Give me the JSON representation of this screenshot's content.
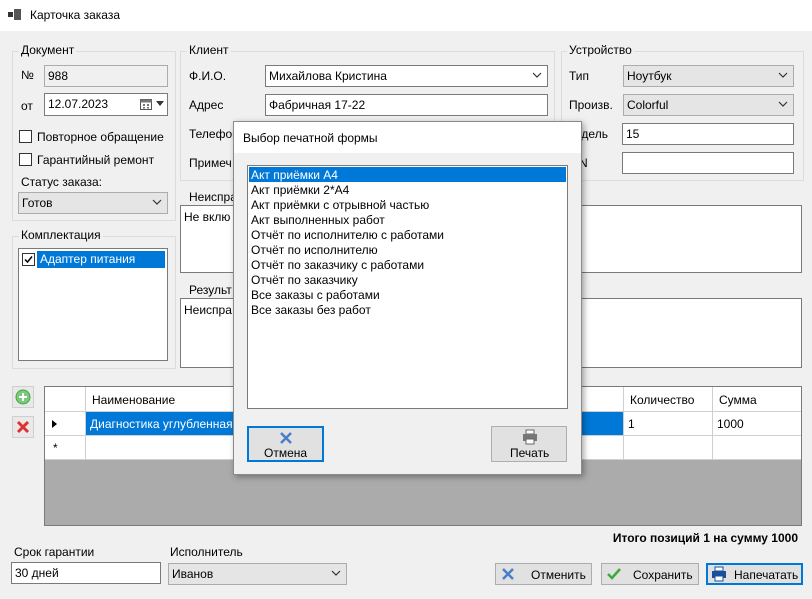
{
  "window": {
    "title": "Карточка заказа"
  },
  "document": {
    "group_title": "Документ",
    "number_label": "№",
    "number_value": "988",
    "date_label": "от",
    "date_value": "12.07.2023",
    "repeat_label": "Повторное обращение",
    "warranty_repair_label": "Гарантийный ремонт",
    "status_label": "Статус заказа:",
    "status_value": "Готов"
  },
  "client": {
    "group_title": "Клиент",
    "fio_label": "Ф.И.О.",
    "fio_value": "Михайлова Кристина",
    "address_label": "Адрес",
    "address_value": "Фабричная 17-22",
    "phone_label": "Телефон",
    "note_label": "Примеч"
  },
  "device": {
    "group_title": "Устройство",
    "type_label": "Тип",
    "type_value": "Ноутбук",
    "maker_label": "Произв.",
    "maker_value": "Colorful",
    "model_label": "одель",
    "model_value": "15",
    "sn_label": "N"
  },
  "kit": {
    "group_title": "Комплектация",
    "items": [
      {
        "label": "Адаптер питания",
        "checked": true
      }
    ]
  },
  "fault": {
    "label": "Неиспра",
    "value": "Не вклю"
  },
  "result": {
    "label": "Результ",
    "value": "Неиспра"
  },
  "grid": {
    "columns": [
      "Наименование",
      "Количество",
      "Сумма"
    ],
    "rows": [
      {
        "name": "Диагностика углубленная",
        "qty": "1",
        "sum": "1000"
      }
    ],
    "new_row_marker": "*"
  },
  "totals": {
    "text": "Итого позиций 1 на сумму 1000"
  },
  "footer": {
    "warranty_label": "Срок гарантии",
    "warranty_value": "30 дней",
    "executor_label": "Исполнитель",
    "executor_value": "Иванов",
    "cancel_label": "Отменить",
    "save_label": "Сохранить",
    "print_label": "Напечатать"
  },
  "dialog": {
    "title": "Выбор печатной формы",
    "items": [
      "Акт приёмки А4",
      "Акт приёмки 2*А4",
      "Акт приёмки с отрывной частью",
      "Акт выполненных работ",
      "Отчёт по исполнителю с работами",
      "Отчёт по исполнителю",
      "Отчёт по заказчику с работами",
      "Отчёт по заказчику",
      "Все заказы с работами",
      "Все заказы без работ"
    ],
    "selected_index": 0,
    "cancel_label": "Отмена",
    "print_label": "Печать"
  },
  "colors": {
    "selection": "#0078d7",
    "grid_bg": "#ababab",
    "delete_red": "#e03030",
    "add_green": "#3cab3c"
  }
}
